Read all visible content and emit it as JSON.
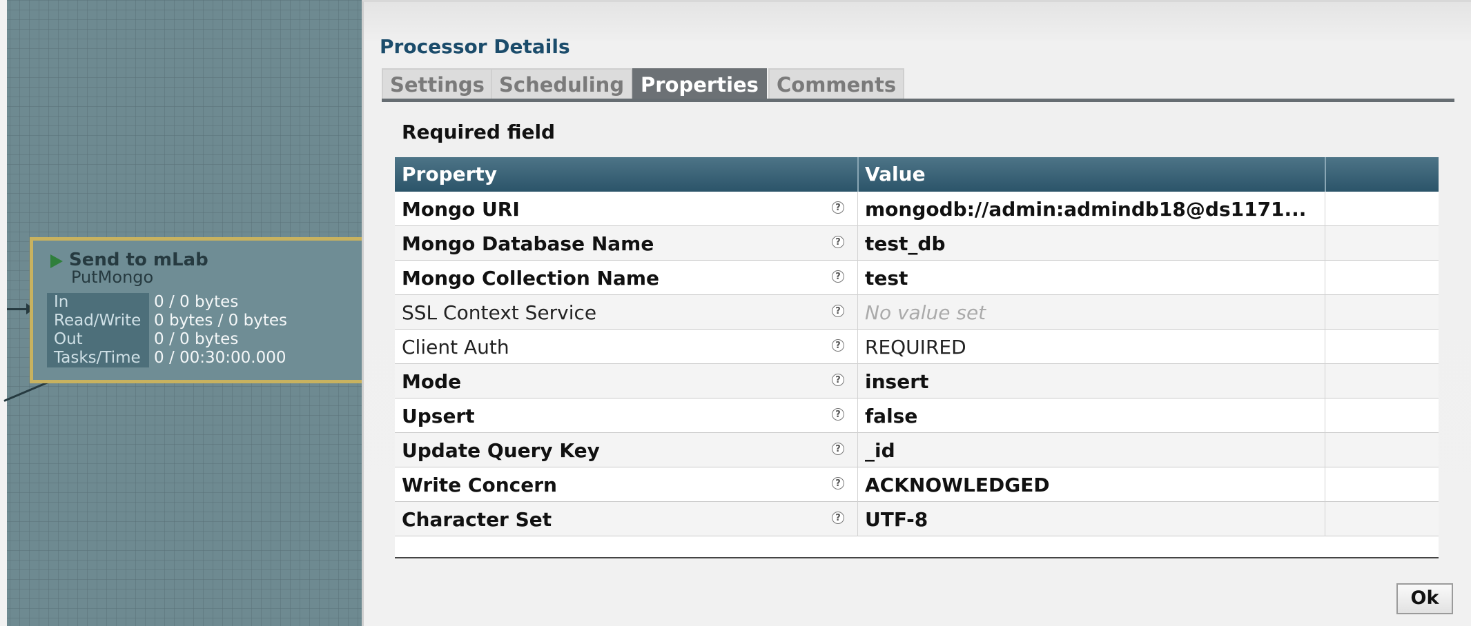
{
  "processor": {
    "name": "Send to mLab",
    "type": "PutMongo",
    "status_icon": "play-triangle-icon",
    "stats": [
      {
        "label": "In",
        "value": "0 / 0 bytes"
      },
      {
        "label": "Read/Write",
        "value": "0 bytes / 0 bytes"
      },
      {
        "label": "Out",
        "value": "0 / 0 bytes"
      },
      {
        "label": "Tasks/Time",
        "value": "0 / 00:30:00.000"
      }
    ]
  },
  "dialog": {
    "title": "Processor Details",
    "tabs": [
      {
        "label": "Settings"
      },
      {
        "label": "Scheduling"
      },
      {
        "label": "Properties"
      },
      {
        "label": "Comments"
      }
    ],
    "active_tab": "Properties",
    "required_note": "Required field",
    "table": {
      "headers": {
        "property": "Property",
        "value": "Value"
      },
      "rows": [
        {
          "name": "Mongo URI",
          "value": "mongodb://admin:admindb18@ds1171...",
          "required": true
        },
        {
          "name": "Mongo Database Name",
          "value": "test_db",
          "required": true
        },
        {
          "name": "Mongo Collection Name",
          "value": "test",
          "required": true
        },
        {
          "name": "SSL Context Service",
          "value": "No value set",
          "required": false
        },
        {
          "name": "Client Auth",
          "value": "REQUIRED",
          "required": false
        },
        {
          "name": "Mode",
          "value": "insert",
          "required": true
        },
        {
          "name": "Upsert",
          "value": "false",
          "required": true
        },
        {
          "name": "Update Query Key",
          "value": "_id",
          "required": true
        },
        {
          "name": "Write Concern",
          "value": "ACKNOWLEDGED",
          "required": true
        },
        {
          "name": "Character Set",
          "value": "UTF-8",
          "required": true
        }
      ],
      "help_icon": "question-circle-icon",
      "help_glyph": "?"
    },
    "ok_label": "Ok"
  },
  "colors": {
    "header": "#2b5469",
    "active_tab": "#6c7175",
    "title": "#1b4c6b"
  }
}
